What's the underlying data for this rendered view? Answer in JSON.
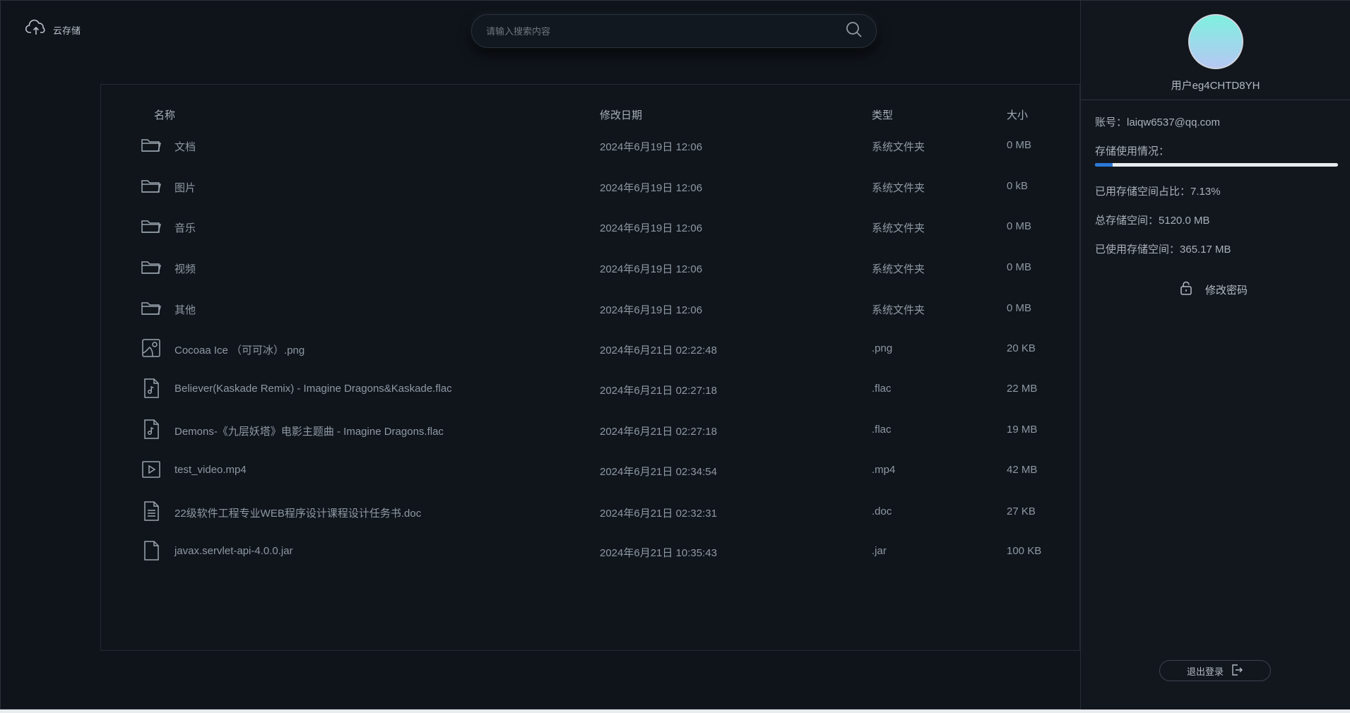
{
  "app": {
    "name": "云存储"
  },
  "search": {
    "placeholder": "请输入搜索内容"
  },
  "table": {
    "headers": {
      "name": "名称",
      "date": "修改日期",
      "type": "类型",
      "size": "大小"
    },
    "rows": [
      {
        "icon": "folder-icon",
        "name": "文档",
        "date": "2024年6月19日 12:06",
        "type": "系统文件夹",
        "size": "0 MB"
      },
      {
        "icon": "folder-icon",
        "name": "图片",
        "date": "2024年6月19日 12:06",
        "type": "系统文件夹",
        "size": "0 kB"
      },
      {
        "icon": "folder-icon",
        "name": "音乐",
        "date": "2024年6月19日 12:06",
        "type": "系统文件夹",
        "size": "0 MB"
      },
      {
        "icon": "folder-icon",
        "name": "视频",
        "date": "2024年6月19日 12:06",
        "type": "系统文件夹",
        "size": "0 MB"
      },
      {
        "icon": "folder-icon",
        "name": "其他",
        "date": "2024年6月19日 12:06",
        "type": "系统文件夹",
        "size": "0 MB"
      },
      {
        "icon": "image-file-icon",
        "name": "Cocoaa Ice （可可冰）.png",
        "date": "2024年6月21日 02:22:48",
        "type": ".png",
        "size": "20 KB"
      },
      {
        "icon": "audio-file-icon",
        "name": "Believer(Kaskade Remix) - Imagine Dragons&Kaskade.flac",
        "date": "2024年6月21日 02:27:18",
        "type": ".flac",
        "size": "22 MB"
      },
      {
        "icon": "audio-file-icon",
        "name": "Demons-《九层妖塔》电影主题曲 - Imagine Dragons.flac",
        "date": "2024年6月21日 02:27:18",
        "type": ".flac",
        "size": "19 MB"
      },
      {
        "icon": "video-file-icon",
        "name": "test_video.mp4",
        "date": "2024年6月21日 02:34:54",
        "type": ".mp4",
        "size": "42 MB"
      },
      {
        "icon": "document-file-icon",
        "name": "22级软件工程专业WEB程序设计课程设计任务书.doc",
        "date": "2024年6月21日 02:32:31",
        "type": ".doc",
        "size": "27 KB"
      },
      {
        "icon": "generic-file-icon",
        "name": "javax.servlet-api-4.0.0.jar",
        "date": "2024年6月21日 10:35:43",
        "type": ".jar",
        "size": "100 KB"
      }
    ]
  },
  "sidebar": {
    "username": "用户eg4CHTD8YH",
    "account_label": "账号：",
    "account": "laiqw6537@qq.com",
    "storage_label": "存储使用情况：",
    "storage_used_fraction": 0.0713,
    "used_ratio_label": "已用存储空间占比：",
    "used_ratio": "7.13%",
    "total_label": "总存储空间：",
    "total": "5120.0 MB",
    "used_label": "已使用存储空间：",
    "used": "365.17 MB",
    "change_password": "修改密码",
    "logout": "退出登录"
  },
  "colors": {
    "accent": "#2b79d9",
    "background": "#0f141b"
  }
}
